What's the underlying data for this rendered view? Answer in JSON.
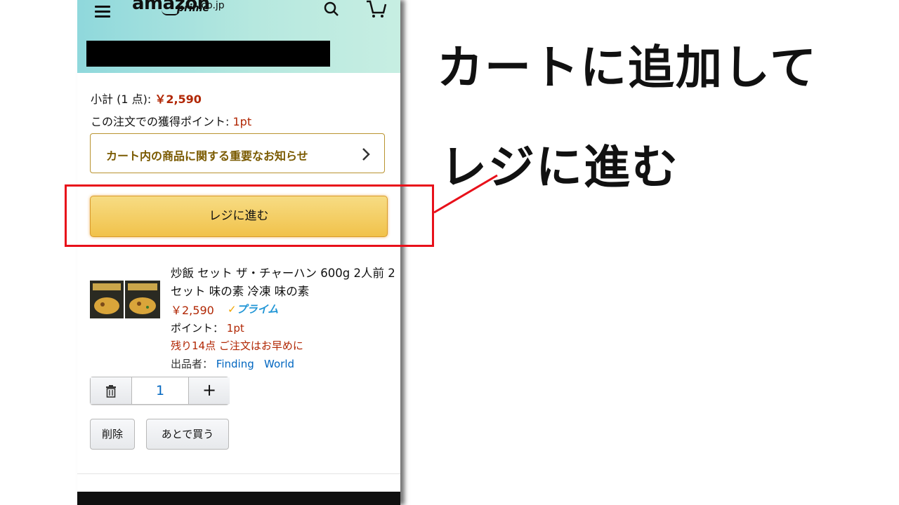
{
  "header": {
    "logo_word": "amazon",
    "logo_tld": ".co.jp",
    "logo_prime": "prime",
    "search_icon": "search-icon",
    "cart_icon": "cart-icon",
    "menu_icon": "hamburger-menu-icon"
  },
  "cart": {
    "subtotal_label": "小計 (1 点): ",
    "subtotal_value": "￥2,590",
    "points_label": "この注文での獲得ポイント: ",
    "points_value": "1pt",
    "notice_label": "カート内の商品に関する重要なお知らせ",
    "checkout_label": "レジに進む"
  },
  "item": {
    "title": "炒飯 セット ザ・チャーハン 600g 2人前 2セット 味の素 冷凍 味の素",
    "price": "￥2,590",
    "prime_check": "✓",
    "prime_label": "プライム",
    "points_label": "ポイント： ",
    "points_value": "1pt",
    "stock": "残り14点 ご注文はお早めに",
    "seller_label": "出品者：",
    "seller_name_1": "Finding",
    "seller_name_2": "World",
    "quantity": "1",
    "plus_label": "+",
    "delete_label": "削除",
    "save_later_label": "あとで買う"
  },
  "annotation": {
    "line1": "カートに追加して",
    "line2": "レジに進む",
    "highlight_color": "#e8101a"
  }
}
